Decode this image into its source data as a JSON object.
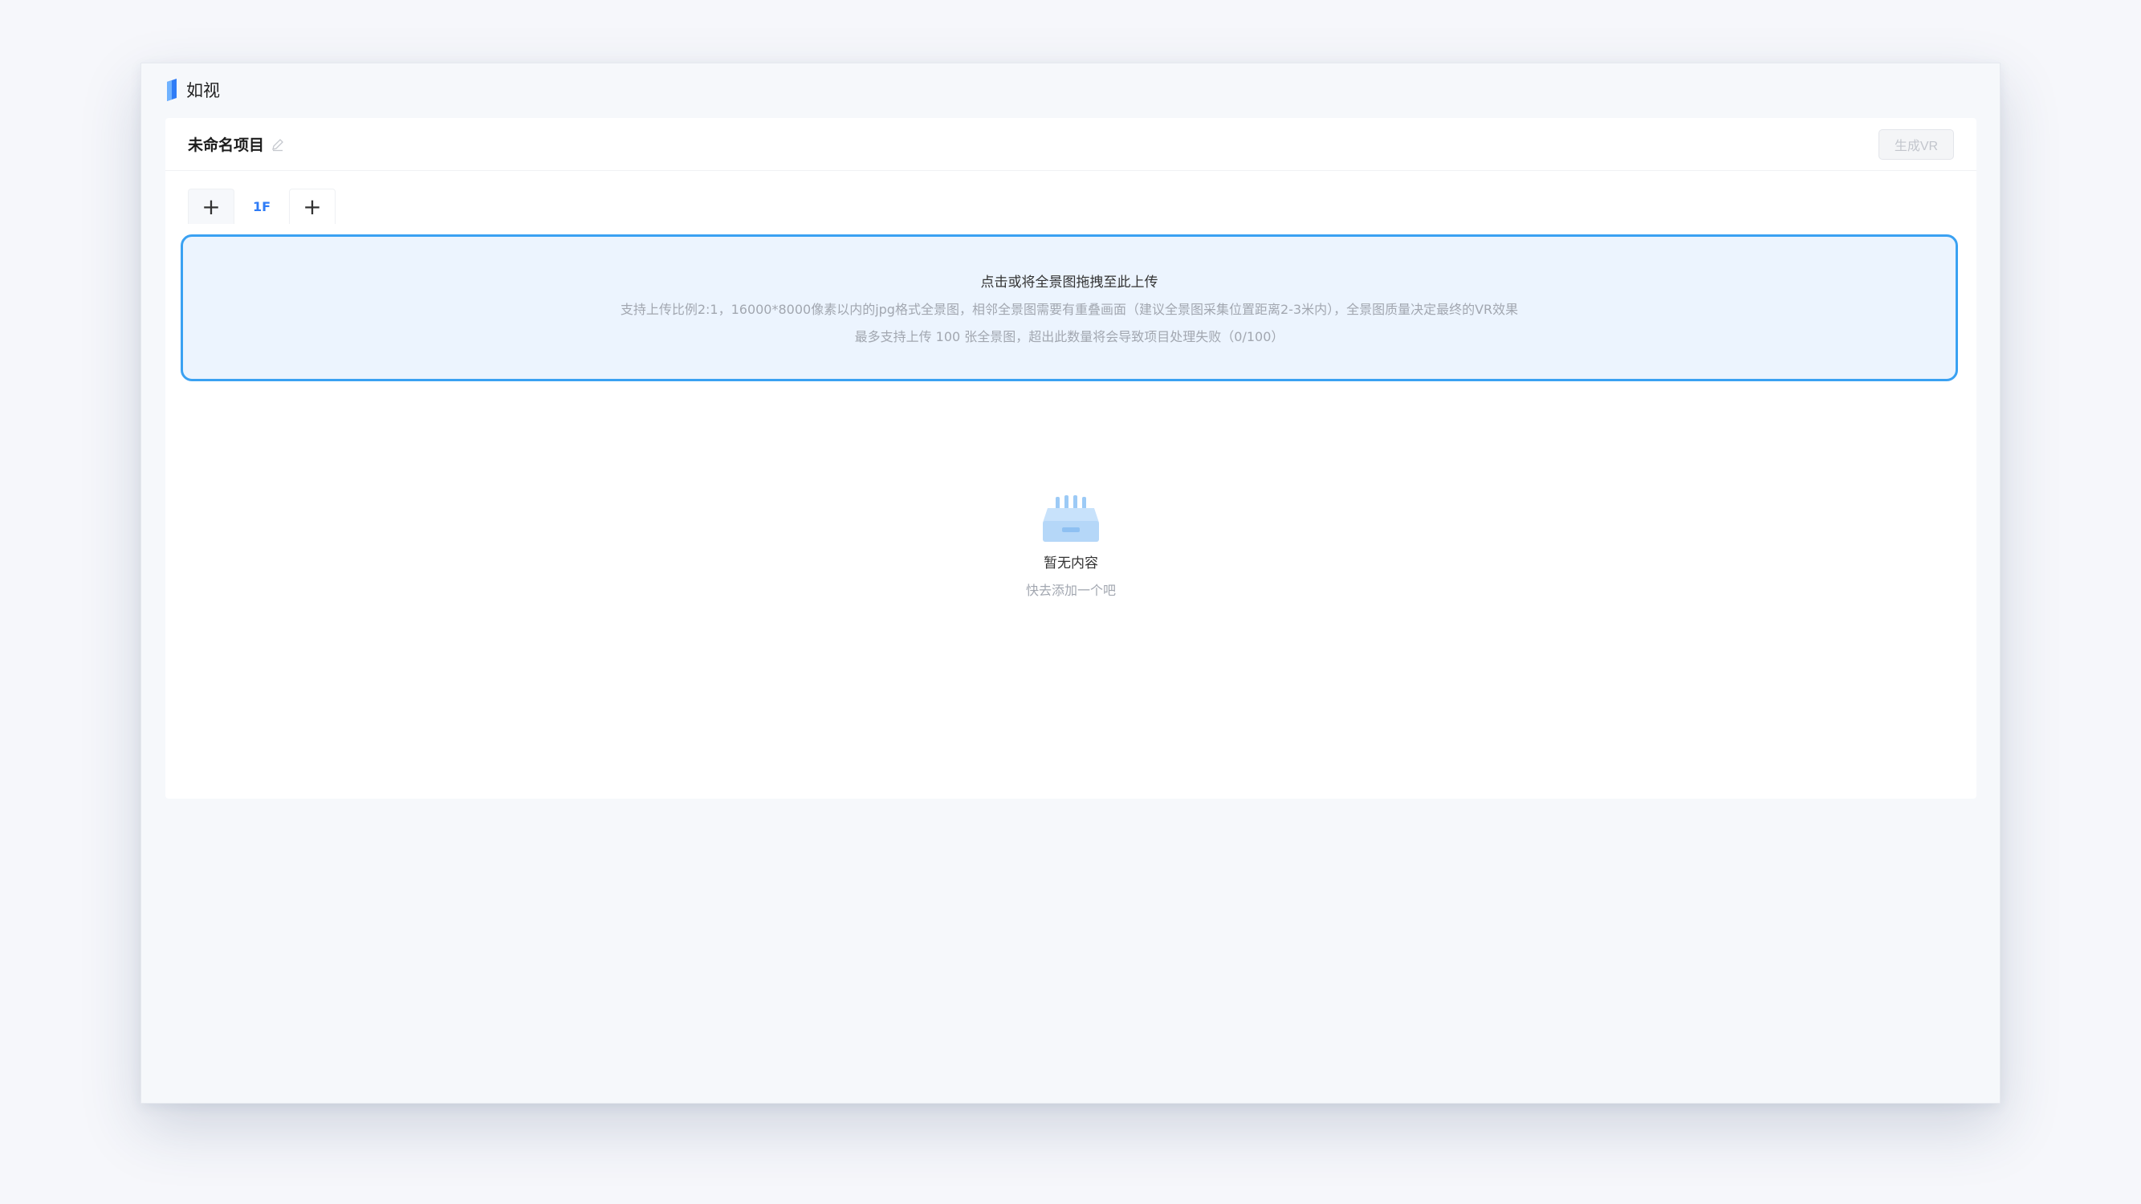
{
  "brand": {
    "name": "如视"
  },
  "project": {
    "title": "未命名项目",
    "generate_label": "生成VR"
  },
  "tabs": [
    {
      "label": "+"
    },
    {
      "label": "1F"
    },
    {
      "label": "+"
    }
  ],
  "upload": {
    "title": "点击或将全景图拖拽至此上传",
    "hint1": "支持上传比例2:1，16000*8000像素以内的jpg格式全景图，相邻全景图需要有重叠画面（建议全景图采集位置距离2-3米内），全景图质量决定最终的VR效果",
    "hint2": "最多支持上传 100 张全景图，超出此数量将会导致项目处理失败（0/100）"
  },
  "empty": {
    "title": "暂无内容",
    "subtitle": "快去添加一个吧"
  },
  "colors": {
    "accent": "#2f7cf6",
    "upload_border": "#3aa1f2",
    "upload_bg": "#ecf4fe"
  }
}
